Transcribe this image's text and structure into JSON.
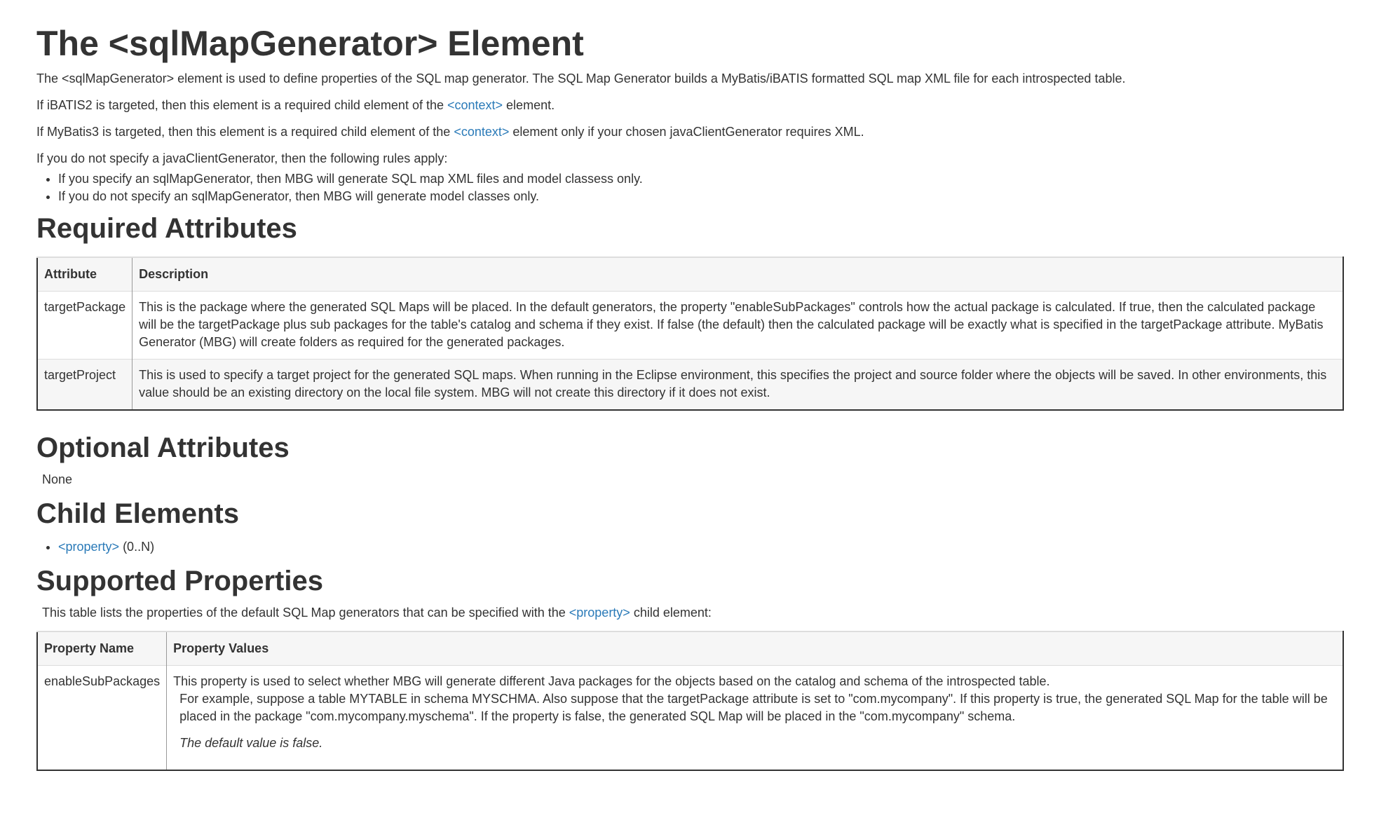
{
  "title": "The <sqlMapGenerator> Element",
  "intro": {
    "p1": "The <sqlMapGenerator> element is used to define properties of the SQL map generator. The SQL Map Generator builds a MyBatis/iBATIS formatted SQL map XML file for each introspected table.",
    "p2_before": "If iBATIS2 is targeted, then this element is a required child element of the ",
    "p2_link": "<context>",
    "p2_after": " element.",
    "p3_before": "If MyBatis3 is targeted, then this element is a required child element of the ",
    "p3_link": "<context>",
    "p3_after": " element only if your chosen javaClientGenerator requires XML.",
    "p4": "If you do not specify a javaClientGenerator, then the following rules apply:",
    "rules": [
      "If you specify an sqlMapGenerator, then MBG will generate SQL map XML files and model classess only.",
      "If you do not specify an sqlMapGenerator, then MBG will generate model classes only."
    ]
  },
  "required": {
    "heading": "Required Attributes",
    "columns": [
      "Attribute",
      "Description"
    ],
    "rows": [
      {
        "name": "targetPackage",
        "description": "This is the package where the generated SQL Maps will be placed. In the default generators, the property \"enableSubPackages\" controls how the actual package is calculated. If true, then the calculated package will be the targetPackage plus sub packages for the table's catalog and schema if they exist. If false (the default) then the calculated package will be exactly what is specified in the targetPackage attribute. MyBatis Generator (MBG) will create folders as required for the generated packages."
      },
      {
        "name": "targetProject",
        "description": "This is used to specify a target project for the generated SQL maps. When running in the Eclipse environment, this specifies the project and source folder where the objects will be saved. In other environments, this value should be an existing directory on the local file system. MBG will not create this directory if it does not exist."
      }
    ]
  },
  "optional": {
    "heading": "Optional Attributes",
    "text": "None"
  },
  "child": {
    "heading": "Child Elements",
    "items": [
      {
        "link": "<property>",
        "suffix": " (0..N)"
      }
    ]
  },
  "supported": {
    "heading": "Supported Properties",
    "intro_before": "This table lists the properties of the default SQL Map generators that can be specified with the ",
    "intro_link": "<property>",
    "intro_after": " child element:",
    "columns": [
      "Property Name",
      "Property Values"
    ],
    "rows": [
      {
        "name": "enableSubPackages",
        "description": "This property is used to select whether MBG will generate different Java packages for the objects based on the catalog and schema of the introspected table.",
        "example": "For example, suppose a table MYTABLE in schema MYSCHMA. Also suppose that the targetPackage attribute is set to \"com.mycompany\". If this property is true, the generated SQL Map for the table will be placed in the package \"com.mycompany.myschema\". If the property is false, the generated SQL Map will be placed in the \"com.mycompany\" schema.",
        "default_note": "The default value is false."
      }
    ]
  },
  "colors": {
    "text": "#333333",
    "link": "#2a7ab8",
    "table_stripe": "#f6f6f6",
    "table_border": "#333333",
    "row_divider": "#dddddd"
  }
}
